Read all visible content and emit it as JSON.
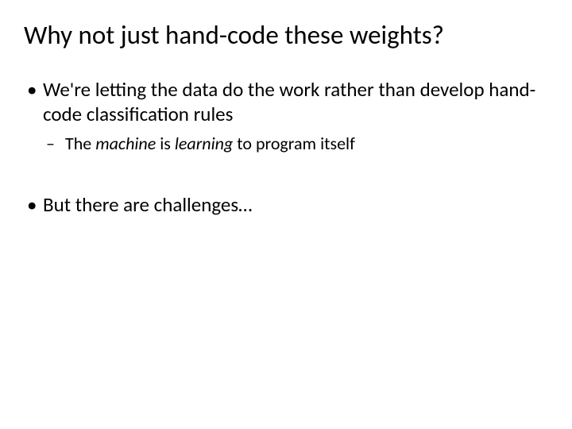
{
  "slide": {
    "title": "Why not just hand-code these weights?",
    "bullets": [
      {
        "text": "We're letting the data do the work rather than develop hand-code classification rules",
        "sub": {
          "pre": "The ",
          "em1": "machine",
          "mid": " is ",
          "em2": "learning",
          "post": " to program itself"
        }
      },
      {
        "text": "But there are challenges…"
      }
    ]
  }
}
